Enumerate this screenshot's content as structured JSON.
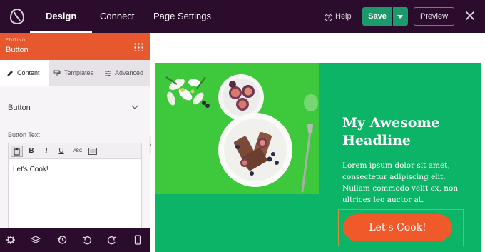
{
  "topbar": {
    "tabs": [
      {
        "label": "Design",
        "active": true
      },
      {
        "label": "Connect",
        "active": false
      },
      {
        "label": "Page Settings",
        "active": false
      }
    ],
    "help_label": "Help",
    "save_label": "Save",
    "preview_label": "Preview"
  },
  "sidebar": {
    "editing_label": "EDITING:",
    "editing_title": "Button",
    "tabs": [
      {
        "label": "Content",
        "active": true
      },
      {
        "label": "Templates",
        "active": false
      },
      {
        "label": "Advanced",
        "active": false
      }
    ],
    "section_title": "Button",
    "field_label": "Button Text",
    "toolbar": {
      "bold": "B",
      "italic": "I",
      "underline": "U",
      "abc": "ABC"
    },
    "editor_value": "Let's Cook!"
  },
  "canvas": {
    "headline": "My Awesome Headline",
    "body": "Lorem ipsum dolor sit amet, consectetur adipiscing elit. Nullam commodo velit ex, non ultrices leo auctor at.",
    "button_label": "Let's Cook!"
  },
  "colors": {
    "topbar_bg": "#2b0c2c",
    "accent_orange": "#e8582f",
    "save_green": "#1d9a6c",
    "panel_green": "#0bb467",
    "photo_green": "#3ec83b",
    "cta_orange": "#f0592a"
  }
}
